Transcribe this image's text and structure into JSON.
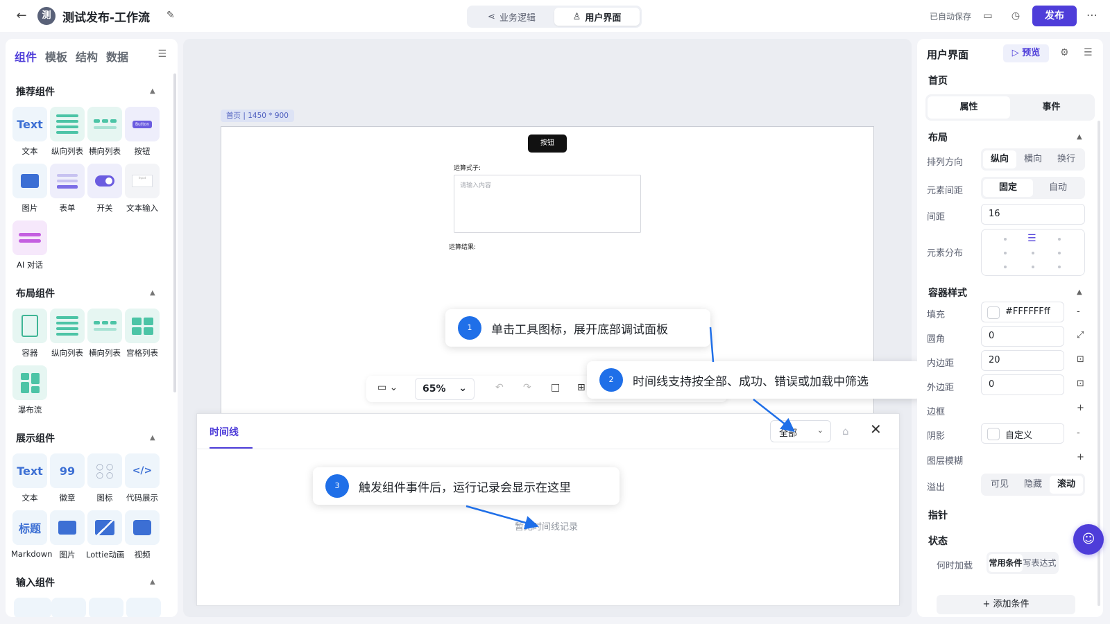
{
  "header": {
    "back_label": "←",
    "avatar_text": "测",
    "title": "测试发布-工作流",
    "modes": [
      {
        "label": "业务逻辑",
        "icon": "share-icon"
      },
      {
        "label": "用户界面",
        "icon": "user-icon"
      }
    ],
    "active_mode": "用户界面",
    "autosave": "已自动保存",
    "publish_label": "发布"
  },
  "left_panel": {
    "tabs": [
      "组件",
      "模板",
      "结构",
      "数据"
    ],
    "sections": [
      {
        "title": "推荐组件",
        "items": [
          "文本",
          "纵向列表",
          "横向列表",
          "按钮",
          "图片",
          "表单",
          "开关",
          "文本输入",
          "AI 对话"
        ]
      },
      {
        "title": "布局组件",
        "items": [
          "容器",
          "纵向列表",
          "横向列表",
          "宫格列表",
          "瀑布流"
        ]
      },
      {
        "title": "展示组件",
        "items": [
          "文本",
          "徽章",
          "图标",
          "代码展示",
          "Markdown",
          "图片",
          "Lottie动画",
          "视频"
        ]
      },
      {
        "title": "输入组件",
        "items": []
      }
    ],
    "tile_text": {
      "text": "Text",
      "badge": "99",
      "code": "</>",
      "title": "标题",
      "button": "Button",
      "input": "Input"
    }
  },
  "canvas": {
    "page_tag": "首页 | 1450 * 900",
    "demo_button": "按钮",
    "formula_label": "运算式子:",
    "formula_placeholder": "请输入内容",
    "result_label": "运算结果:",
    "zoom": "65%"
  },
  "timeline": {
    "tab": "时间线",
    "filter": "全部",
    "empty": "暂无时间线记录"
  },
  "callouts": [
    {
      "num": "1",
      "text": "单击工具图标，展开底部调试面板"
    },
    {
      "num": "2",
      "text": "时间线支持按全部、成功、错误或加载中筛选"
    },
    {
      "num": "3",
      "text": "触发组件事件后，运行记录会显示在这里"
    }
  ],
  "right_panel": {
    "title": "用户界面",
    "preview": "预览",
    "page": "首页",
    "tabs": [
      "属性",
      "事件"
    ],
    "layout_title": "布局",
    "direction_label": "排列方向",
    "direction_options": [
      "纵向",
      "横向",
      "换行"
    ],
    "gap_label": "元素间距",
    "gap_options": [
      "固定",
      "自动"
    ],
    "spacing_label": "间距",
    "spacing_value": "16",
    "distribution_label": "元素分布",
    "container_title": "容器样式",
    "fill_label": "填充",
    "fill_value": "#FFFFFFff",
    "radius_label": "圆角",
    "radius_value": "0",
    "padding_label": "内边距",
    "padding_value": "20",
    "margin_label": "外边距",
    "margin_value": "0",
    "border_label": "边框",
    "shadow_label": "阴影",
    "shadow_value": "自定义",
    "blur_label": "图层模糊",
    "overflow_label": "溢出",
    "overflow_options": [
      "可见",
      "隐藏",
      "滚动"
    ],
    "pointer_title": "指针",
    "state_title": "状态",
    "load_label": "何时加载",
    "load_options": [
      "常用条件",
      "写表达式"
    ],
    "add_condition": "添加条件"
  },
  "colors": {
    "accent": "#4e3dd9",
    "callout_badge": "#1f6fe8",
    "tile_bg": "#eef5fb"
  }
}
